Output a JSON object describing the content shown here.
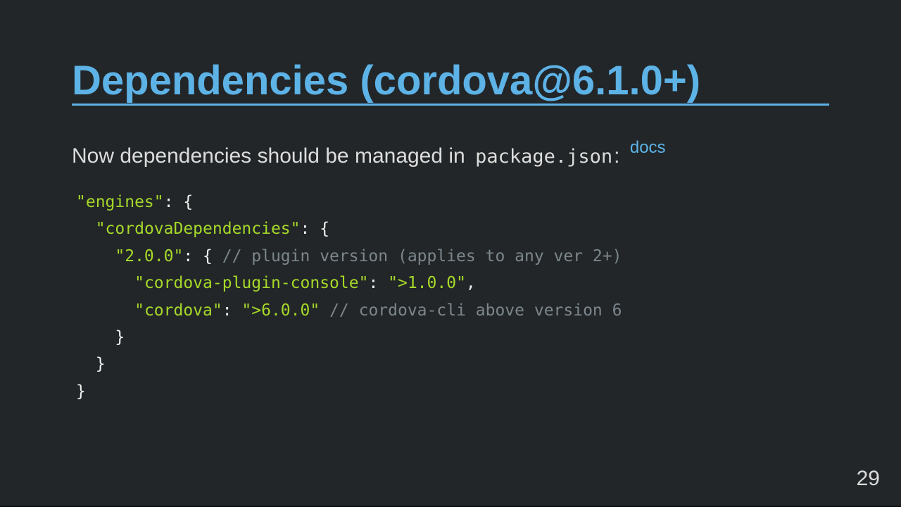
{
  "slide": {
    "title": "Dependencies (cordova@6.1.0+)",
    "intro": {
      "text": "Now dependencies should be managed in",
      "code": "package.json",
      "colon": ":",
      "link": "docs"
    },
    "code": {
      "lines": [
        {
          "indent": "",
          "tokens": [
            {
              "type": "str",
              "text": "\"engines\""
            },
            {
              "type": "punc",
              "text": ": {"
            }
          ]
        },
        {
          "indent": "  ",
          "tokens": [
            {
              "type": "str",
              "text": "\"cordovaDependencies\""
            },
            {
              "type": "punc",
              "text": ": {"
            }
          ]
        },
        {
          "indent": "    ",
          "tokens": [
            {
              "type": "str",
              "text": "\"2.0.0\""
            },
            {
              "type": "punc",
              "text": ": { "
            },
            {
              "type": "cmt",
              "text": "// plugin version (applies to any ver 2+)"
            }
          ]
        },
        {
          "indent": "      ",
          "tokens": [
            {
              "type": "str",
              "text": "\"cordova-plugin-console\""
            },
            {
              "type": "punc",
              "text": ": "
            },
            {
              "type": "str",
              "text": "\">1.0.0\""
            },
            {
              "type": "punc",
              "text": ","
            }
          ]
        },
        {
          "indent": "      ",
          "tokens": [
            {
              "type": "str",
              "text": "\"cordova\""
            },
            {
              "type": "punc",
              "text": ": "
            },
            {
              "type": "str",
              "text": "\">6.0.0\""
            },
            {
              "type": "punc",
              "text": " "
            },
            {
              "type": "cmt",
              "text": "// cordova-cli above version 6"
            }
          ]
        },
        {
          "indent": "    ",
          "tokens": [
            {
              "type": "punc",
              "text": "}"
            }
          ]
        },
        {
          "indent": "  ",
          "tokens": [
            {
              "type": "punc",
              "text": "}"
            }
          ]
        },
        {
          "indent": "",
          "tokens": [
            {
              "type": "punc",
              "text": "}"
            }
          ]
        }
      ]
    },
    "page_number": "29"
  },
  "colors": {
    "background": "#222628",
    "accent": "#5db2e6",
    "text": "#dcdcdc",
    "string": "#a6d82a",
    "comment": "#7c868c"
  }
}
